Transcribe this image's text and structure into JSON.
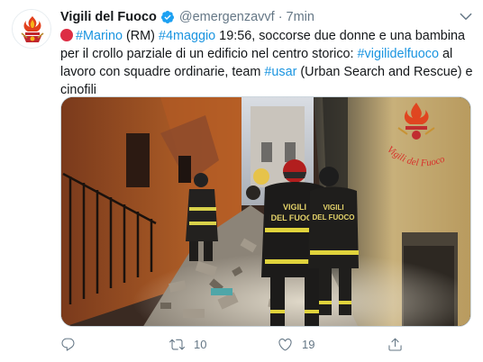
{
  "tweet": {
    "display_name": "Vigili del Fuoco",
    "handle": "@emergenzavvf",
    "separator": "·",
    "time": "7min",
    "text_parts": {
      "hashtag_marino": "#Marino",
      "t1": " (RM) ",
      "hashtag_date": "#4maggio",
      "t2": " 19:56, soccorse due donne e una bambina per il crollo parziale di un edificio nel centro storico: ",
      "hashtag_vigili": "#vigilidelfuoco",
      "t3": " al lavoro con squadre ordinarie, team ",
      "hashtag_usar": "#usar",
      "t4": " (Urban Search and Rescue) e cinofili"
    },
    "media": {
      "watermark": "Vigili del Fuoco",
      "jacket_label_1": "VIGILI\nDEL FUOCO",
      "jacket_label_2": "VIGILI\nDEL FUOCO"
    },
    "actions": {
      "reply_count": "",
      "retweet_count": "10",
      "like_count": "19"
    }
  },
  "icons": [
    "avatar-logo-icon",
    "verified-icon",
    "chevron-down-icon",
    "red-circle-emoji-icon",
    "reply-icon",
    "retweet-icon",
    "like-icon",
    "share-icon"
  ],
  "colors": {
    "link": "#1b95e0",
    "verified": "#1da1f2",
    "muted": "#657786",
    "emoji_red": "#dd2e44"
  }
}
